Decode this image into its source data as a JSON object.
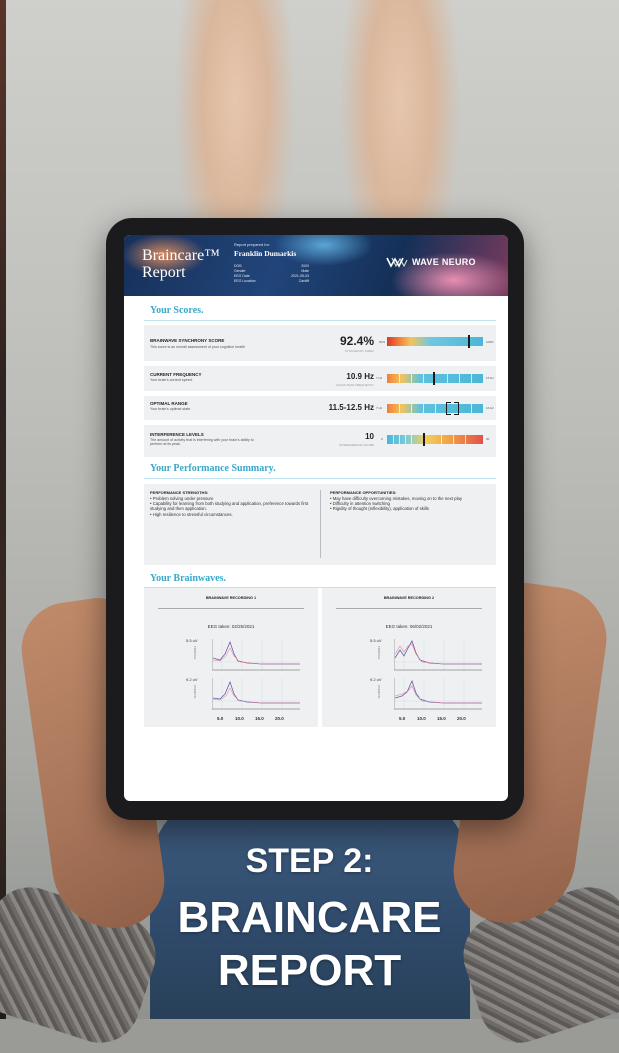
{
  "report": {
    "brand_top": "Braincare™",
    "brand_bottom": "Report",
    "prepared_for_label": "Report prepared for:",
    "patient_name": "Franklin Dumarkis",
    "meta": [
      {
        "label": "DOB",
        "value": "2000"
      },
      {
        "label": "Gender",
        "value": "Male"
      },
      {
        "label": "EEG Date",
        "value": "2021-05-03"
      },
      {
        "label": "EEG Location",
        "value": "Cardiff"
      }
    ],
    "logo_text": "WAVE NEURO"
  },
  "scores": {
    "heading": "Your Scores.",
    "rows": [
      {
        "title": "BRAINWAVE SYNCHRONY SCORE",
        "desc": "This score is an overall assessment of your cognitive health",
        "value": "92.4%",
        "sub": "SYNCHRONY INDEX",
        "min_label": "50%",
        "max_label": "100%",
        "marker_fraction": 0.85
      },
      {
        "title": "CURRENT FREQUENCY",
        "desc": "Your brain's current speed.",
        "value": "10.9 Hz",
        "sub": "ALPHA PEAK FREQUENCY",
        "min_label": "7 Hz",
        "max_label": "15 Hz",
        "marker_fraction": 0.48
      },
      {
        "title": "OPTIMAL RANGE",
        "desc": "Your brain's optimal state.",
        "value": "11.5-12.5 Hz",
        "sub": "",
        "min_label": "7 Hz",
        "max_label": "16 Hz",
        "range_from_fraction": 0.62,
        "range_to_fraction": 0.74
      },
      {
        "title": "INTERFERENCE LEVELS",
        "desc": "The amount of activity that is interfering with your brain's ability to perform at its peak.",
        "value": "10",
        "sub": "INTERFERENCE SCORE",
        "min_label": "0",
        "max_label": "30",
        "marker_fraction": 0.38
      }
    ]
  },
  "performance": {
    "heading": "Your Performance Summary.",
    "strengths_title": "PERFORMANCE STRENGTHS:",
    "strengths": [
      "• Problem solving under pressure",
      "• Capability for learning from both studying and application, preference towards first studying and then application.",
      "• High resilience to stressful circumstances."
    ],
    "opportunities_title": "PERFORMANCE OPPORTUNITIES:",
    "opportunities": [
      "• May have difficulty overcoming mistakes, moving on to the next play",
      "• Difficulty in attention switching",
      "• Rigidity of thought (inflexibility), application of skills"
    ]
  },
  "brainwaves": {
    "heading": "Your Brainwaves.",
    "recordings": [
      {
        "title": "BRAINWAVE RECORDING 1",
        "date": "EEG taken: 02/25/2021",
        "top_value": "5.5 uV",
        "bottom_value": "9.2 uV",
        "top_axis": "FRONTAL",
        "bottom_axis": "PARIETAL",
        "x_ticks": [
          "5.0",
          "10.0",
          "15.0",
          "20.0"
        ]
      },
      {
        "title": "BRAINWAVE RECORDING 2",
        "date": "EEG taken: 06/02/2021",
        "top_value": "5.5 uV",
        "bottom_value": "9.2 uV",
        "top_axis": "FRONTAL",
        "bottom_axis": "PARIETAL",
        "x_ticks": [
          "5.0",
          "10.0",
          "15.0",
          "20.0"
        ]
      }
    ]
  },
  "caption": {
    "line1": "STEP 2:",
    "line2": "BRAINCARE",
    "line3": "REPORT"
  },
  "colors": {
    "accent": "#3aa8c9",
    "caption": "#ffffff",
    "panel": "#eef0f2"
  }
}
